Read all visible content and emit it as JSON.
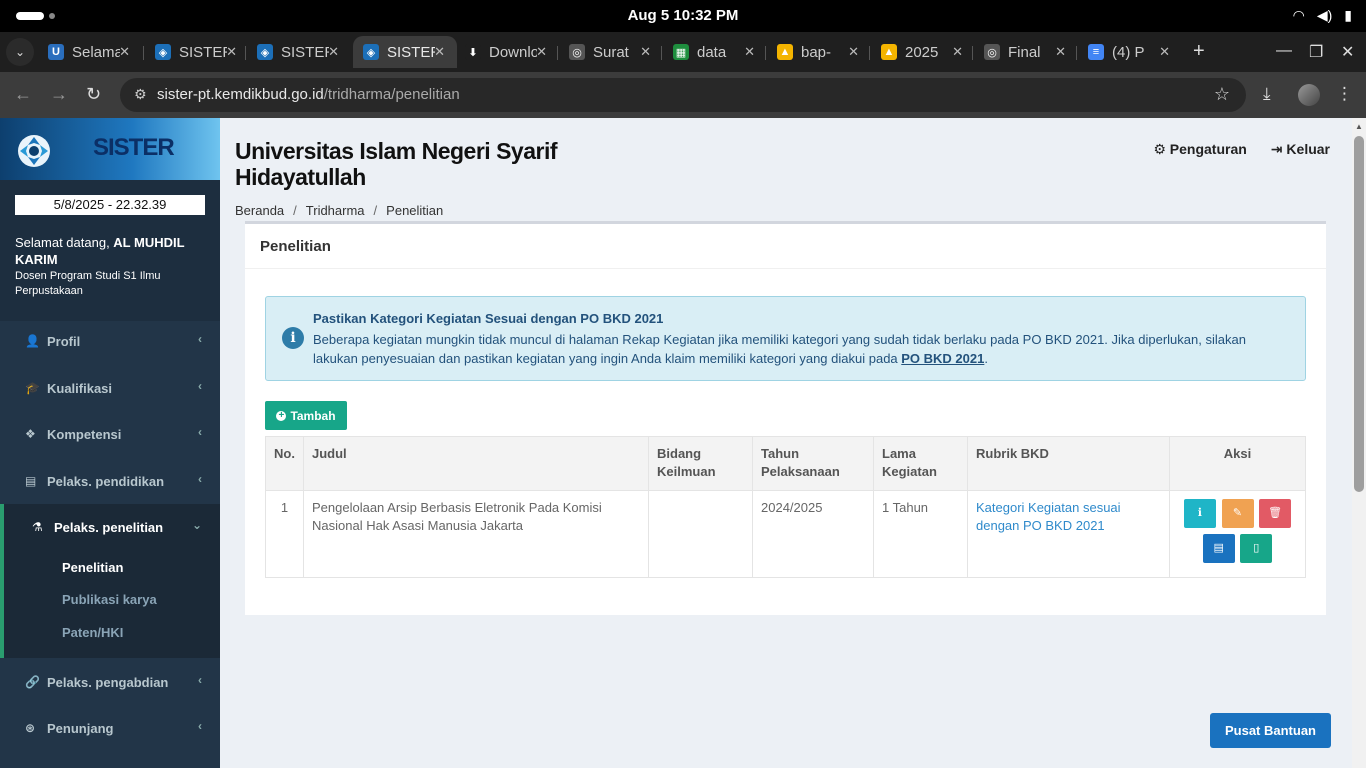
{
  "os": {
    "clock": "Aug 5  10:32 PM"
  },
  "browser": {
    "tabs": [
      {
        "title": "Selamat",
        "favicon_color": "#2a6ebd",
        "favicon_glyph": "U"
      },
      {
        "title": "SISTER",
        "favicon_color": "#1c6fb8",
        "favicon_glyph": "◈"
      },
      {
        "title": "SISTER",
        "favicon_color": "#1c6fb8",
        "favicon_glyph": "◈"
      },
      {
        "title": "SISTER",
        "favicon_color": "#1c6fb8",
        "favicon_glyph": "◈",
        "active": true
      },
      {
        "title": "Downloads",
        "favicon_color": "#1f1f1f",
        "favicon_glyph": "⬇"
      },
      {
        "title": "Surat",
        "favicon_color": "#555555",
        "favicon_glyph": "◎"
      },
      {
        "title": "data",
        "favicon_color": "#1e8e3e",
        "favicon_glyph": "▦"
      },
      {
        "title": "bap-",
        "favicon_color": "#f4b400",
        "favicon_glyph": "▲"
      },
      {
        "title": "2025",
        "favicon_color": "#f4b400",
        "favicon_glyph": "▲"
      },
      {
        "title": "Final",
        "favicon_color": "#555555",
        "favicon_glyph": "◎"
      },
      {
        "title": "(4) P",
        "favicon_color": "#4285f4",
        "favicon_glyph": "≡"
      }
    ],
    "url_host": "sister-pt.kemdikbud.go.id",
    "url_path": "/tridharma/penelitian"
  },
  "sidebar": {
    "brand": "SISTER",
    "datetime": "5/8/2025 - 22.32.39",
    "welcome_prefix": "Selamat datang, ",
    "user_name": "AL MUHDIL KARIM",
    "role": "Dosen Program Studi S1 Ilmu Perpustakaan",
    "menu": [
      {
        "label": "Profil",
        "icon": "user-icon"
      },
      {
        "label": "Kualifikasi",
        "icon": "graduation-cap-icon"
      },
      {
        "label": "Kompetensi",
        "icon": "cubes-icon"
      },
      {
        "label": "Pelaks. pendidikan",
        "icon": "book-icon"
      },
      {
        "label": "Pelaks. penelitian",
        "icon": "flask-icon",
        "open": true
      },
      {
        "label": "Pelaks. pengabdian",
        "icon": "link-icon"
      },
      {
        "label": "Penunjang",
        "icon": "life-ring-icon"
      }
    ],
    "submenu": [
      {
        "label": "Penelitian",
        "current": true
      },
      {
        "label": "Publikasi karya"
      },
      {
        "label": "Paten/HKI"
      }
    ]
  },
  "header": {
    "institution": "Universitas Islam Negeri Syarif Hidayatullah",
    "settings_label": "Pengaturan",
    "logout_label": "Keluar"
  },
  "breadcrumb": [
    "Beranda",
    "Tridharma",
    "Penelitian"
  ],
  "card": {
    "title": "Penelitian",
    "alert_title": "Pastikan Kategori Kegiatan Sesuai dengan PO BKD 2021",
    "alert_body": "Beberapa kegiatan mungkin tidak muncul di halaman Rekap Kegiatan jika memiliki kategori yang sudah tidak berlaku pada PO BKD 2021. Jika diperlukan, silakan lakukan penyesuaian dan pastikan kegiatan yang ingin Anda klaim memiliki kategori yang diakui pada ",
    "alert_link": "PO BKD 2021",
    "alert_tail": ".",
    "add_label": "Tambah"
  },
  "table": {
    "headers": [
      "No.",
      "Judul",
      "Bidang Keilmuan",
      "Tahun Pelaksanaan",
      "Lama Kegiatan",
      "Rubrik BKD",
      "Aksi"
    ],
    "rows": [
      {
        "no": "1",
        "judul": "Pengelolaan Arsip Berbasis Eletronik Pada Komisi Nasional Hak Asasi Manusia Jakarta",
        "bidang": "",
        "tahun": "2024/2025",
        "lama": "1 Tahun",
        "rubrik": "Kategori Kegiatan sesuai dengan PO BKD 2021"
      }
    ],
    "action_colors": {
      "info": "#1fb5c7",
      "edit": "#f0a252",
      "delete": "#e25a65",
      "book": "#1a72bf",
      "file": "#17a689"
    }
  },
  "help_label": "Pusat Bantuan"
}
